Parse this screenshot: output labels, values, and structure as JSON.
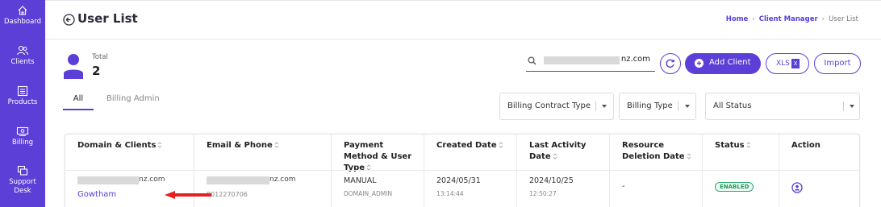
{
  "sidebar": {
    "items": [
      {
        "label": "Dashboard",
        "icon": "home-icon"
      },
      {
        "label": "Clients",
        "icon": "users-icon"
      },
      {
        "label": "Products",
        "icon": "products-icon"
      },
      {
        "label": "Billing",
        "icon": "billing-icon"
      },
      {
        "label": "Support Desk",
        "icon": "support-icon"
      }
    ]
  },
  "header": {
    "title": "User List",
    "breadcrumb": [
      "Home",
      "Client Manager",
      "User List"
    ]
  },
  "summary": {
    "total_label": "Total",
    "total_value": "2"
  },
  "search": {
    "value": "nz.com"
  },
  "toolbar": {
    "add_client": "Add Client",
    "xls": "XLS",
    "import": "Import"
  },
  "tabs": [
    {
      "label": "All",
      "active": true
    },
    {
      "label": "Billing Admin",
      "active": false
    }
  ],
  "filters": [
    {
      "label": "Billing Contract Type"
    },
    {
      "label": "Billing Type"
    },
    {
      "label": "All Status"
    }
  ],
  "table": {
    "headers": [
      "Domain & Clients",
      "Email & Phone",
      "Payment Method & User Type",
      "Created Date",
      "Last Activity Date",
      "Resource Deletion Date",
      "Status",
      "Action"
    ],
    "rows": [
      {
        "domain": "nz.com",
        "client": "Gowtham",
        "email": "nz.com",
        "phone": "8012270706",
        "payment_method": "MANUAL",
        "user_type": "DOMAIN_ADMIN",
        "created_date": "2024/05/31",
        "created_time": "13:14:44",
        "last_activity_date": "2024/10/25",
        "last_activity_time": "12:50:27",
        "resource_deletion": "-",
        "status": "ENABLED"
      }
    ]
  },
  "colors": {
    "accent": "#5b3fd6",
    "status_enabled": "#1e9a5e",
    "annotation_arrow": "#e5201f"
  }
}
